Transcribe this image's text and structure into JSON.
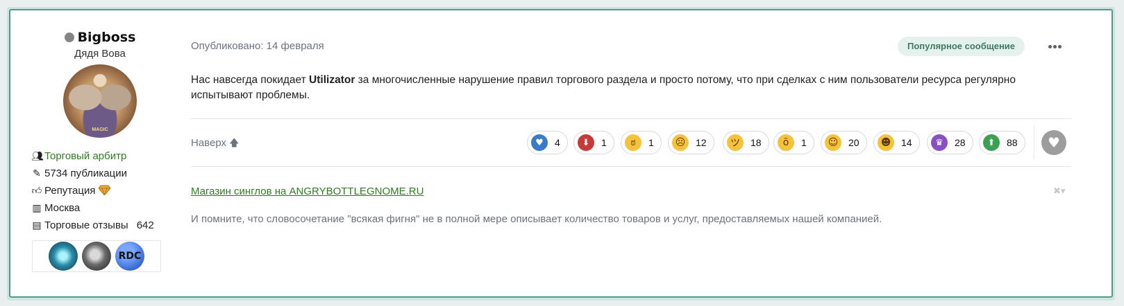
{
  "author": {
    "name": "Bigboss",
    "title": "Дядя Вова",
    "avatar_caption": "MAGIC",
    "stats": {
      "role": "Торговый арбитр",
      "posts": "5734 публикации",
      "reputation_label": "Репутация",
      "city": "Москва",
      "reviews_label": "Торговые отзывы",
      "reviews_count": "642"
    },
    "badges": [
      "RDC"
    ]
  },
  "post": {
    "published": "Опубликовано: 14 февраля",
    "popular_label": "Популярное сообщение",
    "content_before": "Нас навсегда покидает ",
    "content_bold": "Utilizator",
    "content_after": " за многочисленные нарушение правил торгового раздела и просто потому, что при сделках с ним пользователи ресурса регулярно испытывают проблемы.",
    "top_link": "Наверх",
    "reactions": [
      {
        "icon": "heart-icon",
        "count": "4"
      },
      {
        "icon": "thumb-down-icon",
        "count": "1"
      },
      {
        "icon": "angry-face-icon",
        "count": "1"
      },
      {
        "icon": "sad-face-icon",
        "count": "12"
      },
      {
        "icon": "confused-face-icon",
        "count": "18"
      },
      {
        "icon": "rolling-eyes-icon",
        "count": "1"
      },
      {
        "icon": "drooling-face-icon",
        "count": "20"
      },
      {
        "icon": "laughing-face-icon",
        "count": "14"
      },
      {
        "icon": "trophy-icon",
        "count": "28"
      },
      {
        "icon": "upvote-icon",
        "count": "88"
      }
    ]
  },
  "signature": {
    "link": "Магазин синглов на ANGRYBOTTLEGNOME.RU",
    "text": "И помните, что словосочетание \"всякая фигня\" не в полной мере описывает количество товаров и услуг, предоставляемых нашей компанией."
  },
  "colors": {
    "accent": "#4f9b89",
    "link_green": "#2e7d1e",
    "popular_bg": "#e4f1ec"
  }
}
